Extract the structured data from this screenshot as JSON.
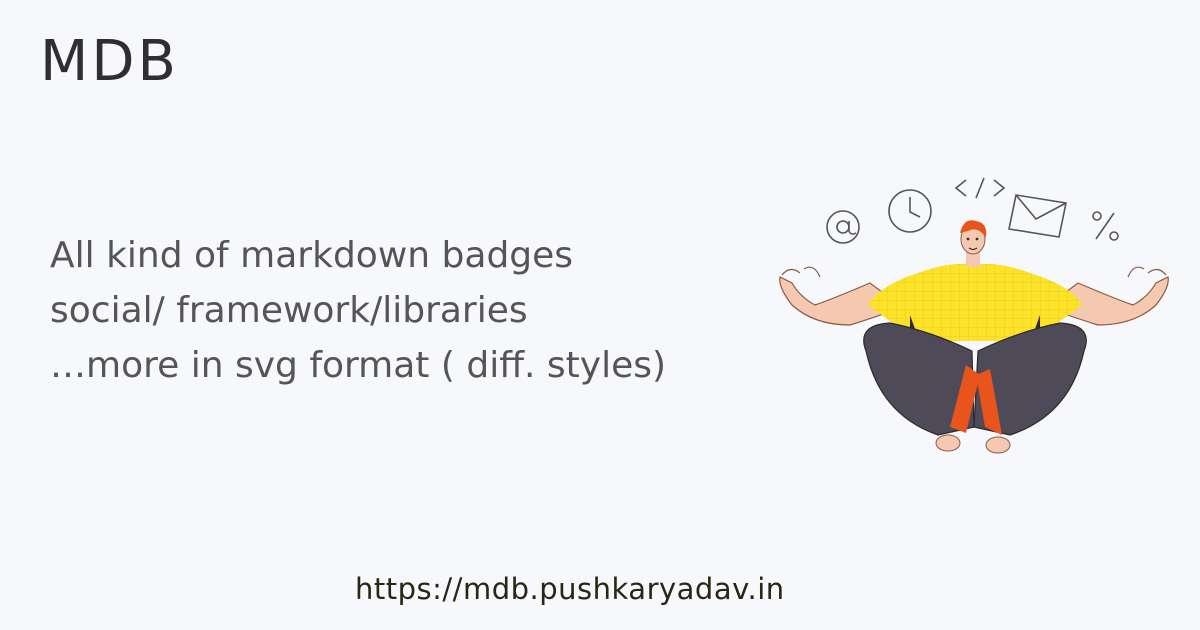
{
  "brand": {
    "title": "MDB"
  },
  "tagline": {
    "lines": [
      "All kind of markdown badges",
      "social/ framework/libraries",
      "…more in svg format ( diff. styles)"
    ]
  },
  "footer": {
    "url": "https://mdb.pushkaryadav.in"
  },
  "illustration": {
    "subject": "meditating-developer",
    "floating_icons": [
      "at-sign-icon",
      "clock-icon",
      "code-icon",
      "envelope-icon",
      "percent-icon"
    ],
    "colors": {
      "background": "#f7f8fc",
      "shirt": "#fde22a",
      "pants": "#4e4a57",
      "skin": "#f5c9b0",
      "hair": "#e8541c",
      "accent": "#e8541c"
    }
  }
}
